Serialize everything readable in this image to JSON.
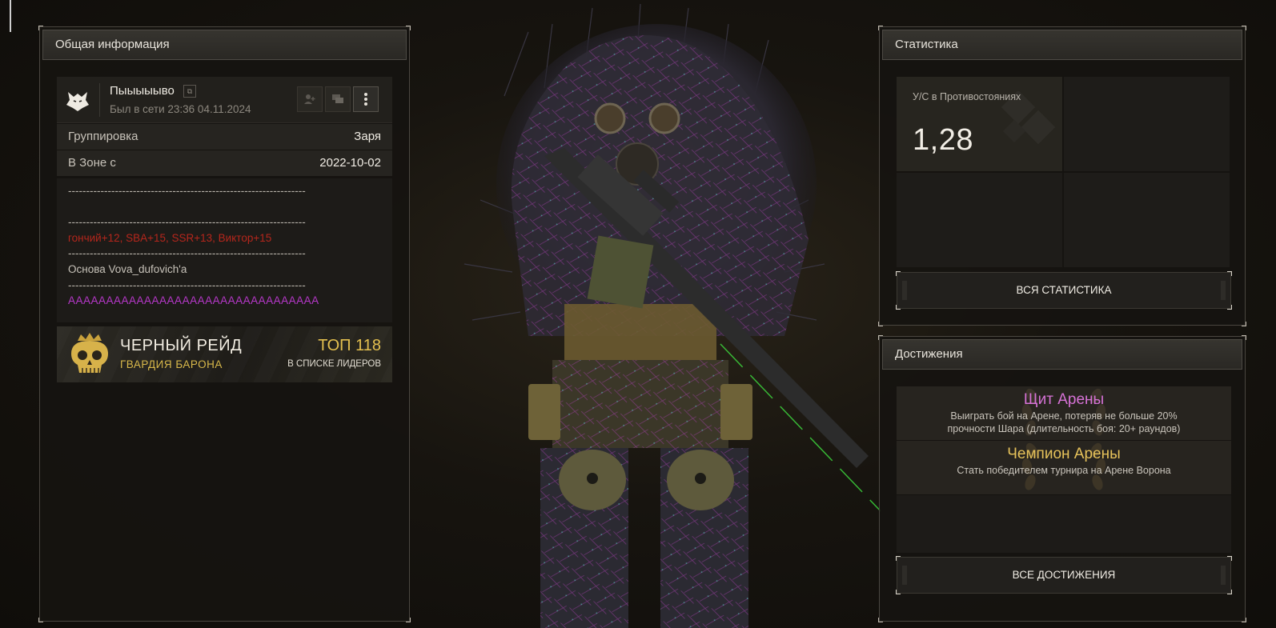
{
  "info_panel": {
    "title": "Общая информация",
    "player_name": "Пыыыыыво",
    "last_seen": "Был в сети 23:36 04.11.2024",
    "faction_label": "Группировка",
    "faction_value": "Заря",
    "zone_label": "В Зоне с",
    "zone_value": "2022-10-02",
    "bio": [
      "------------------------------------------------------------------",
      "",
      "------------------------------------------------------------------",
      "гончий+12, SBA+15, SSR+13, Виктор+15",
      "------------------------------------------------------------------",
      "Основа Vova_dufovich'a",
      "------------------------------------------------------------------",
      "AAAAAAAAAAAAAAAAAAAAAAAAAAAAAAAAA"
    ],
    "raid": {
      "title": "ЧЕРНЫЙ РЕЙД",
      "subtitle": "ГВАРДИЯ БАРОНА",
      "rank": "ТОП 118",
      "rank_sub": "В СПИСКЕ ЛИДЕРОВ"
    }
  },
  "stats_panel": {
    "title": "Статистика",
    "stat_label": "У/С в Противостояниях",
    "stat_value": "1,28",
    "button": "ВСЯ СТАТИСТИКА"
  },
  "achievements_panel": {
    "title": "Достижения",
    "items": [
      {
        "title": "Щит Арены",
        "desc_line1": "Выиграть бой на Арене, потеряв не больше 20%",
        "desc_line2": "прочности Шара (длительность боя: 20+ раундов)"
      },
      {
        "title": "Чемпион Арены",
        "desc_line1": "Стать победителем турнира на Арене Ворона",
        "desc_line2": ""
      }
    ],
    "button": "ВСЕ ДОСТИЖЕНИЯ"
  },
  "icons": {
    "avatar": "wolf-icon",
    "copy": "copy-icon",
    "add_friend": "add-friend-icon",
    "chat": "chat-icon",
    "more": "more-vertical-icon",
    "raid": "skull-crown-icon"
  },
  "colors": {
    "achievement_1": "#d672d6",
    "achievement_2": "#e6c25a",
    "raid_gold": "#e4c04f",
    "bio_red": "#b5261c",
    "bio_purple": "#b638c9"
  }
}
